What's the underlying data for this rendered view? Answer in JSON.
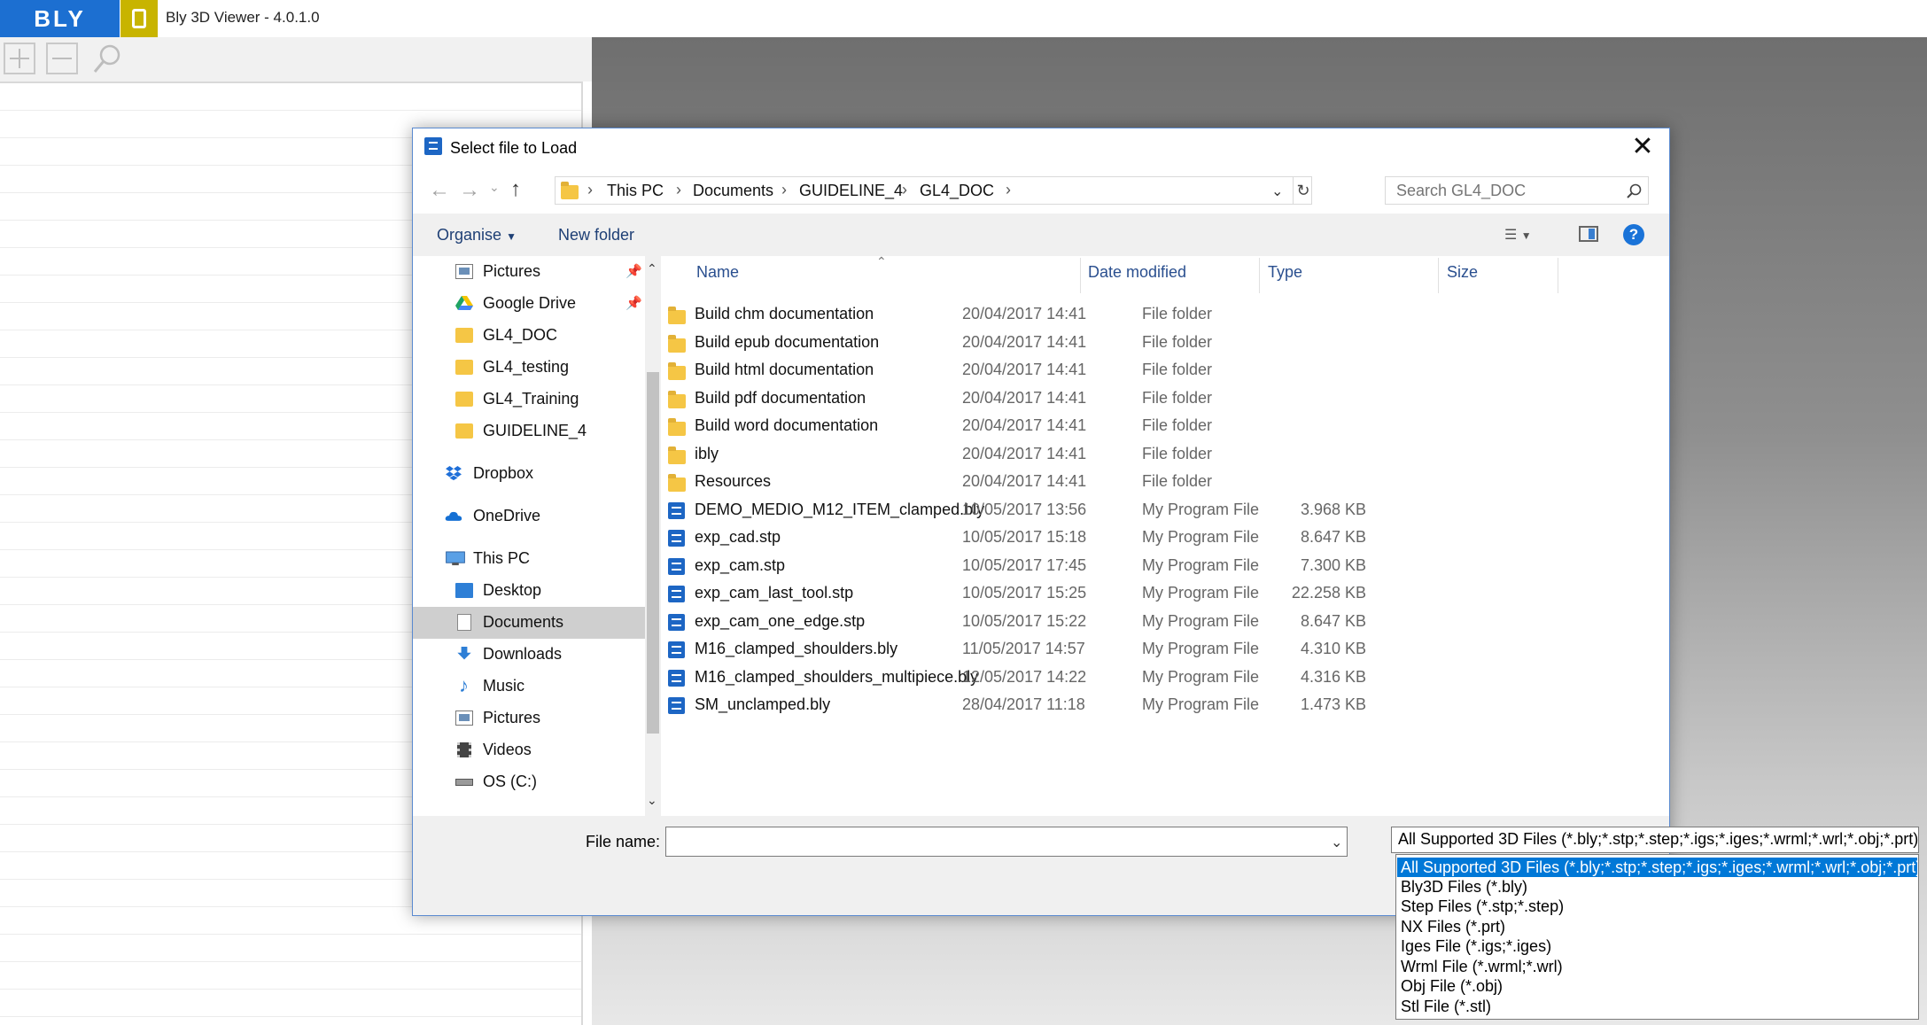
{
  "app": {
    "logo_text": "BLY",
    "title": "Bly 3D Viewer - 4.0.1.0",
    "tool_icons": [
      "zoom-in-icon",
      "zoom-out-icon",
      "search-icon"
    ]
  },
  "dialog": {
    "title": "Select file to Load",
    "close_glyph": "✕",
    "breadcrumb": [
      "This PC",
      "Documents",
      "GUIDELINE_4",
      "GL4_DOC"
    ],
    "search_placeholder": "Search GL4_DOC",
    "commands": {
      "organise": "Organise",
      "new_folder": "New folder"
    },
    "nav_items": [
      {
        "label": "Pictures",
        "icon": "pictures-icon",
        "pinned": true
      },
      {
        "label": "Google Drive",
        "icon": "google-drive-icon",
        "pinned": true
      },
      {
        "label": "GL4_DOC",
        "icon": "folder-icon"
      },
      {
        "label": "GL4_testing",
        "icon": "folder-icon"
      },
      {
        "label": "GL4_Training",
        "icon": "folder-icon"
      },
      {
        "label": "GUIDELINE_4",
        "icon": "folder-icon"
      },
      {
        "label": "Dropbox",
        "icon": "dropbox-icon"
      },
      {
        "label": "OneDrive",
        "icon": "onedrive-icon"
      },
      {
        "label": "This PC",
        "icon": "computer-icon"
      },
      {
        "label": "Desktop",
        "icon": "desktop-icon"
      },
      {
        "label": "Documents",
        "icon": "documents-icon",
        "selected": true
      },
      {
        "label": "Downloads",
        "icon": "downloads-icon"
      },
      {
        "label": "Music",
        "icon": "music-icon"
      },
      {
        "label": "Pictures",
        "icon": "pictures-icon"
      },
      {
        "label": "Videos",
        "icon": "videos-icon"
      },
      {
        "label": "OS (C:)",
        "icon": "drive-icon"
      }
    ],
    "columns": {
      "name": "Name",
      "date": "Date modified",
      "type": "Type",
      "size": "Size"
    },
    "files": [
      {
        "name": "Build chm documentation",
        "date": "20/04/2017 14:41",
        "type": "File folder",
        "size": "",
        "kind": "folder"
      },
      {
        "name": "Build epub documentation",
        "date": "20/04/2017 14:41",
        "type": "File folder",
        "size": "",
        "kind": "folder"
      },
      {
        "name": "Build html documentation",
        "date": "20/04/2017 14:41",
        "type": "File folder",
        "size": "",
        "kind": "folder"
      },
      {
        "name": "Build pdf documentation",
        "date": "20/04/2017 14:41",
        "type": "File folder",
        "size": "",
        "kind": "folder"
      },
      {
        "name": "Build word documentation",
        "date": "20/04/2017 14:41",
        "type": "File folder",
        "size": "",
        "kind": "folder"
      },
      {
        "name": "ibly",
        "date": "20/04/2017 14:41",
        "type": "File folder",
        "size": "",
        "kind": "folder"
      },
      {
        "name": "Resources",
        "date": "20/04/2017 14:41",
        "type": "File folder",
        "size": "",
        "kind": "folder"
      },
      {
        "name": "DEMO_MEDIO_M12_ITEM_clamped.bly",
        "date": "10/05/2017 13:56",
        "type": "My Program File",
        "size": "3.968 KB",
        "kind": "file"
      },
      {
        "name": "exp_cad.stp",
        "date": "10/05/2017 15:18",
        "type": "My Program File",
        "size": "8.647 KB",
        "kind": "file"
      },
      {
        "name": "exp_cam.stp",
        "date": "10/05/2017 17:45",
        "type": "My Program File",
        "size": "7.300 KB",
        "kind": "file"
      },
      {
        "name": "exp_cam_last_tool.stp",
        "date": "10/05/2017 15:25",
        "type": "My Program File",
        "size": "22.258 KB",
        "kind": "file"
      },
      {
        "name": "exp_cam_one_edge.stp",
        "date": "10/05/2017 15:22",
        "type": "My Program File",
        "size": "8.647 KB",
        "kind": "file"
      },
      {
        "name": "M16_clamped_shoulders.bly",
        "date": "11/05/2017 14:57",
        "type": "My Program File",
        "size": "4.310 KB",
        "kind": "file"
      },
      {
        "name": "M16_clamped_shoulders_multipiece.bly",
        "date": "12/05/2017 14:22",
        "type": "My Program File",
        "size": "4.316 KB",
        "kind": "file"
      },
      {
        "name": "SM_unclamped.bly",
        "date": "28/04/2017 11:18",
        "type": "My Program File",
        "size": "1.473 KB",
        "kind": "file"
      }
    ],
    "file_name_label": "File name:",
    "file_name_value": "",
    "filter": {
      "selected": "All Supported 3D Files (*.bly;*.stp;*.step;*.igs;*.iges;*.wrml;*.wrl;*.obj;*.prt)",
      "options": [
        "All Supported 3D Files (*.bly;*.stp;*.step;*.igs;*.iges;*.wrml;*.wrl;*.obj;*.prt)",
        "Bly3D Files (*.bly)",
        "Step Files (*.stp;*.step)",
        "NX Files (*.prt)",
        "Iges File (*.igs;*.iges)",
        "Wrml File (*.wrml;*.wrl)",
        "Obj File (*.obj)",
        "Stl File (*.stl)"
      ]
    }
  },
  "colors": {
    "accent": "#1c6fd1",
    "selection": "#0078d7",
    "folder": "#f5c645",
    "link": "#1e3f75"
  }
}
